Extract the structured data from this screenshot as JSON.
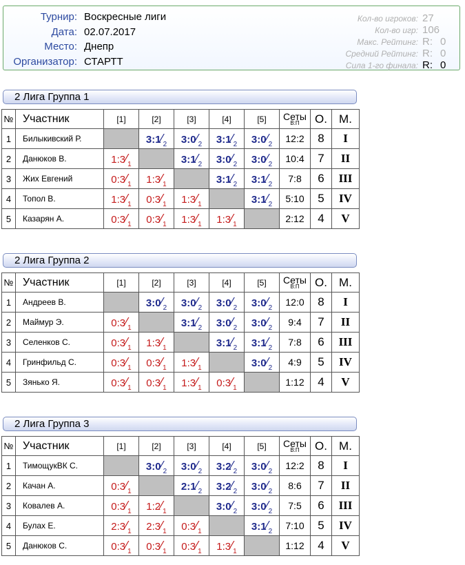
{
  "info": {
    "tournament_label": "Турнир:",
    "tournament": "Воскресные лиги",
    "date_label": "Дата:",
    "date": "02.07.2017",
    "place_label": "Место:",
    "place": "Днепр",
    "organizer_label": "Организатор:",
    "organizer": "СТАРТТ",
    "stats": {
      "players_label": "Кол-во игроков:",
      "players": "27",
      "games_label": "Кол-во игр:",
      "games": "106",
      "max_rating_label": "Макс. Рейтинг:",
      "max_rating_r": "R:",
      "max_rating": "0",
      "avg_rating_label": "Средний Рейтинг:",
      "avg_rating_r": "R:",
      "avg_rating": "0",
      "final_label": "Сила 1-го финала:",
      "final_r": "R:",
      "final": "0"
    }
  },
  "headers": {
    "num": "№",
    "participant": "Участник",
    "cols": [
      "[1]",
      "[2]",
      "[3]",
      "[4]",
      "[5]"
    ],
    "sets": "Сеты",
    "sets_sub": "В:П",
    "points": "О.",
    "place": "М."
  },
  "groups": [
    {
      "title": "2 Лига Группа 1",
      "rows": [
        {
          "num": "1",
          "name": "Билыкивский Р.",
          "results": [
            null,
            {
              "s": "3:1",
              "p": "2",
              "w": true
            },
            {
              "s": "3:0",
              "p": "2",
              "w": true
            },
            {
              "s": "3:1",
              "p": "2",
              "w": true
            },
            {
              "s": "3:0",
              "p": "2",
              "w": true
            }
          ],
          "sets": "12:2",
          "points": "8",
          "place": "I"
        },
        {
          "num": "2",
          "name": "Данюков В.",
          "results": [
            {
              "s": "1:3",
              "p": "1",
              "w": false
            },
            null,
            {
              "s": "3:1",
              "p": "2",
              "w": true
            },
            {
              "s": "3:0",
              "p": "2",
              "w": true
            },
            {
              "s": "3:0",
              "p": "2",
              "w": true
            }
          ],
          "sets": "10:4",
          "points": "7",
          "place": "II"
        },
        {
          "num": "3",
          "name": "Жих Евгений",
          "results": [
            {
              "s": "0:3",
              "p": "1",
              "w": false
            },
            {
              "s": "1:3",
              "p": "1",
              "w": false
            },
            null,
            {
              "s": "3:1",
              "p": "2",
              "w": true
            },
            {
              "s": "3:1",
              "p": "2",
              "w": true
            }
          ],
          "sets": "7:8",
          "points": "6",
          "place": "III"
        },
        {
          "num": "4",
          "name": "Топол В.",
          "results": [
            {
              "s": "1:3",
              "p": "1",
              "w": false
            },
            {
              "s": "0:3",
              "p": "1",
              "w": false
            },
            {
              "s": "1:3",
              "p": "1",
              "w": false
            },
            null,
            {
              "s": "3:1",
              "p": "2",
              "w": true
            }
          ],
          "sets": "5:10",
          "points": "5",
          "place": "IV"
        },
        {
          "num": "5",
          "name": "Казарян А.",
          "results": [
            {
              "s": "0:3",
              "p": "1",
              "w": false
            },
            {
              "s": "0:3",
              "p": "1",
              "w": false
            },
            {
              "s": "1:3",
              "p": "1",
              "w": false
            },
            {
              "s": "1:3",
              "p": "1",
              "w": false
            },
            null
          ],
          "sets": "2:12",
          "points": "4",
          "place": "V"
        }
      ]
    },
    {
      "title": "2 Лига Группа 2",
      "rows": [
        {
          "num": "1",
          "name": "Андреев В.",
          "results": [
            null,
            {
              "s": "3:0",
              "p": "2",
              "w": true
            },
            {
              "s": "3:0",
              "p": "2",
              "w": true
            },
            {
              "s": "3:0",
              "p": "2",
              "w": true
            },
            {
              "s": "3:0",
              "p": "2",
              "w": true
            }
          ],
          "sets": "12:0",
          "points": "8",
          "place": "I"
        },
        {
          "num": "2",
          "name": "Маймур Э.",
          "results": [
            {
              "s": "0:3",
              "p": "1",
              "w": false
            },
            null,
            {
              "s": "3:1",
              "p": "2",
              "w": true
            },
            {
              "s": "3:0",
              "p": "2",
              "w": true
            },
            {
              "s": "3:0",
              "p": "2",
              "w": true
            }
          ],
          "sets": "9:4",
          "points": "7",
          "place": "II"
        },
        {
          "num": "3",
          "name": "Селенков С.",
          "results": [
            {
              "s": "0:3",
              "p": "1",
              "w": false
            },
            {
              "s": "1:3",
              "p": "1",
              "w": false
            },
            null,
            {
              "s": "3:1",
              "p": "2",
              "w": true
            },
            {
              "s": "3:1",
              "p": "2",
              "w": true
            }
          ],
          "sets": "7:8",
          "points": "6",
          "place": "III"
        },
        {
          "num": "4",
          "name": "Гринфильд С.",
          "results": [
            {
              "s": "0:3",
              "p": "1",
              "w": false
            },
            {
              "s": "0:3",
              "p": "1",
              "w": false
            },
            {
              "s": "1:3",
              "p": "1",
              "w": false
            },
            null,
            {
              "s": "3:0",
              "p": "2",
              "w": true
            }
          ],
          "sets": "4:9",
          "points": "5",
          "place": "IV"
        },
        {
          "num": "5",
          "name": "Зянько Я.",
          "results": [
            {
              "s": "0:3",
              "p": "1",
              "w": false
            },
            {
              "s": "0:3",
              "p": "1",
              "w": false
            },
            {
              "s": "1:3",
              "p": "1",
              "w": false
            },
            {
              "s": "0:3",
              "p": "1",
              "w": false
            },
            null
          ],
          "sets": "1:12",
          "points": "4",
          "place": "V"
        }
      ]
    },
    {
      "title": "2 Лига Группа 3",
      "rows": [
        {
          "num": "1",
          "name": "ТимощукВК С.",
          "results": [
            null,
            {
              "s": "3:0",
              "p": "2",
              "w": true
            },
            {
              "s": "3:0",
              "p": "2",
              "w": true
            },
            {
              "s": "3:2",
              "p": "2",
              "w": true
            },
            {
              "s": "3:0",
              "p": "2",
              "w": true
            }
          ],
          "sets": "12:2",
          "points": "8",
          "place": "I"
        },
        {
          "num": "2",
          "name": "Качан А.",
          "results": [
            {
              "s": "0:3",
              "p": "1",
              "w": false
            },
            null,
            {
              "s": "2:1",
              "p": "2",
              "w": true
            },
            {
              "s": "3:2",
              "p": "2",
              "w": true
            },
            {
              "s": "3:0",
              "p": "2",
              "w": true
            }
          ],
          "sets": "8:6",
          "points": "7",
          "place": "II"
        },
        {
          "num": "3",
          "name": "Ковалев А.",
          "results": [
            {
              "s": "0:3",
              "p": "1",
              "w": false
            },
            {
              "s": "1:2",
              "p": "1",
              "w": false
            },
            null,
            {
              "s": "3:0",
              "p": "2",
              "w": true
            },
            {
              "s": "3:0",
              "p": "2",
              "w": true
            }
          ],
          "sets": "7:5",
          "points": "6",
          "place": "III"
        },
        {
          "num": "4",
          "name": "Булах Е.",
          "results": [
            {
              "s": "2:3",
              "p": "1",
              "w": false
            },
            {
              "s": "2:3",
              "p": "1",
              "w": false
            },
            {
              "s": "0:3",
              "p": "1",
              "w": false
            },
            null,
            {
              "s": "3:1",
              "p": "2",
              "w": true
            }
          ],
          "sets": "7:10",
          "points": "5",
          "place": "IV"
        },
        {
          "num": "5",
          "name": "Данюков С.",
          "results": [
            {
              "s": "0:3",
              "p": "1",
              "w": false
            },
            {
              "s": "0:3",
              "p": "1",
              "w": false
            },
            {
              "s": "0:3",
              "p": "1",
              "w": false
            },
            {
              "s": "1:3",
              "p": "1",
              "w": false
            },
            null
          ],
          "sets": "1:12",
          "points": "4",
          "place": "V"
        }
      ]
    }
  ],
  "colors": {
    "win": "#1f2a8c",
    "loss": "#c41a1a",
    "self_cell": "#c0c0c0",
    "label_blue": "#2d4aa0"
  }
}
